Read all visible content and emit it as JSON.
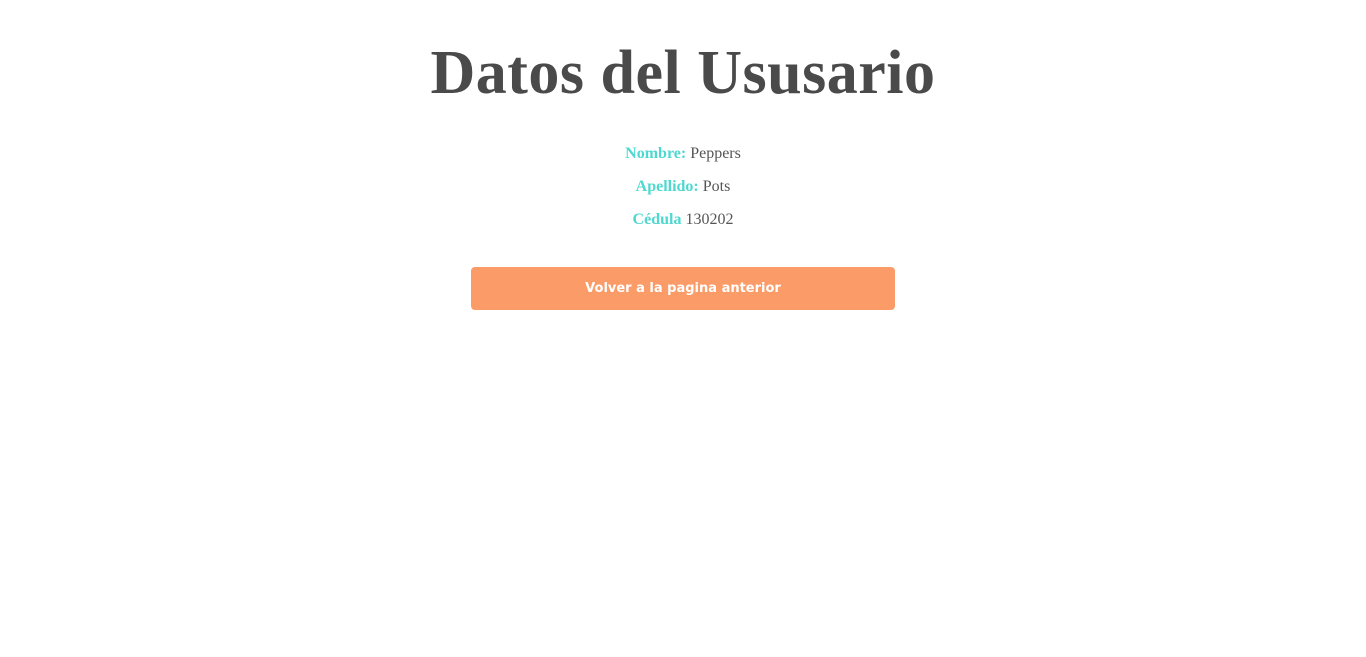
{
  "page": {
    "title": "Datos del Ususario"
  },
  "user": {
    "nombre_label": "Nombre:",
    "nombre_value": "Peppers",
    "apellido_label": "Apellido:",
    "apellido_value": "Pots",
    "cedula_label": "Cédula",
    "cedula_value": "130202"
  },
  "actions": {
    "back_label": "Volver a la pagina anterior"
  },
  "colors": {
    "label_accent": "#4fd8cf",
    "button_bg": "#fb9b68",
    "title_text": "#4a4a4a"
  }
}
